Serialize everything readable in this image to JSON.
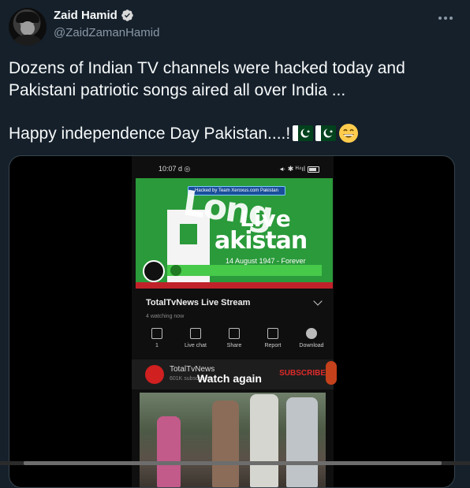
{
  "author": {
    "name": "Zaid Hamid",
    "handle": "@ZaidZamanHamid",
    "verified": true
  },
  "tweet": {
    "line1": "Dozens of Indian TV channels were hacked today and Pakistani patriotic songs aired all over India ...",
    "line2": "Happy independence Day Pakistan....!",
    "emojis": [
      "pakistan-flag",
      "pakistan-flag",
      "grinning-face"
    ]
  },
  "media": {
    "status_time": "10:07",
    "status_extra": "d ◎",
    "status_right": "◂· ✱ ᴴ⁴ıl",
    "video_overlay": "Hacked by Team Xeroxus.com Pakistan",
    "banner_line1": "Long",
    "banner_line2": "Live",
    "banner_line3": "akistan",
    "banner_date": "14 August 1947 - Forever",
    "stream_title": "TotalTvNews Live Stream",
    "watching": "4 watching now",
    "actions": [
      {
        "label": "1",
        "icon": "dislike-icon"
      },
      {
        "label": "Live chat",
        "icon": "chat-icon"
      },
      {
        "label": "Share",
        "icon": "share-icon"
      },
      {
        "label": "Report",
        "icon": "flag-icon"
      },
      {
        "label": "Download",
        "icon": "download-icon"
      }
    ],
    "channel_name": "TotalTvNews",
    "channel_subs": "601K subscribers",
    "subscribe": "SUBSCRIBE",
    "watch_again": "Watch again"
  },
  "colors": {
    "background": "#15202b",
    "text": "#f7f9f9",
    "muted": "#8b98a5",
    "verified": "#1d9bf0",
    "banner_green": "#2a9a3a"
  }
}
